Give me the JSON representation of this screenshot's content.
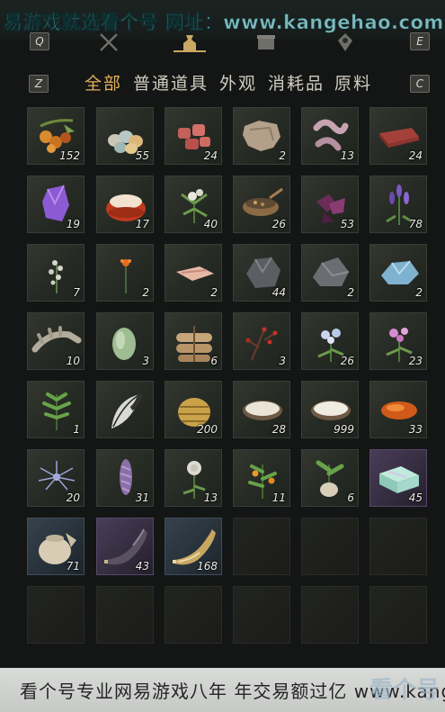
{
  "watermark_top": "易游戏就选看个号  网址：www.kangehao.com",
  "watermark_bottom": "看个号专业网易游戏八年  年交易额过亿  www.kangehao.com",
  "watermark_logo": "看个号",
  "keys": {
    "left": "Q",
    "right": "E",
    "prev_cat": "Z",
    "next_cat": "C"
  },
  "tabs": [
    {
      "icon": "crossed-swords-icon"
    },
    {
      "icon": "bag-icon"
    },
    {
      "icon": "box-icon"
    },
    {
      "icon": "gem-icon"
    }
  ],
  "active_tab": "bag-icon",
  "categories": [
    "全部",
    "普通道具",
    "外观",
    "消耗品",
    "原料"
  ],
  "active_category": "全部",
  "items": [
    {
      "icon": "fruit-branch-icon",
      "count": "152"
    },
    {
      "icon": "eggs-icon",
      "count": "55"
    },
    {
      "icon": "meat-chunks-icon",
      "count": "24"
    },
    {
      "icon": "hide-icon",
      "count": "2"
    },
    {
      "icon": "intestines-icon",
      "count": "13"
    },
    {
      "icon": "steak-icon",
      "count": "24"
    },
    {
      "icon": "amethyst-icon",
      "count": "19"
    },
    {
      "icon": "jelly-bowl-icon",
      "count": "17"
    },
    {
      "icon": "white-flower-icon",
      "count": "40"
    },
    {
      "icon": "grain-bowl-icon",
      "count": "26"
    },
    {
      "icon": "purple-flower-icon",
      "count": "53"
    },
    {
      "icon": "lavender-icon",
      "count": "78"
    },
    {
      "icon": "white-herb-icon",
      "count": "7"
    },
    {
      "icon": "orange-flower-icon",
      "count": "2"
    },
    {
      "icon": "fish-slice-icon",
      "count": "2"
    },
    {
      "icon": "grey-ore-icon",
      "count": "44"
    },
    {
      "icon": "stone-icon",
      "count": "2"
    },
    {
      "icon": "ice-crystal-icon",
      "count": "2"
    },
    {
      "icon": "bone-icon",
      "count": "10"
    },
    {
      "icon": "melon-icon",
      "count": "3"
    },
    {
      "icon": "rice-sacks-icon",
      "count": "6"
    },
    {
      "icon": "red-berry-twig-icon",
      "count": "3"
    },
    {
      "icon": "blue-flower-icon",
      "count": "26"
    },
    {
      "icon": "pink-flower-icon",
      "count": "23"
    },
    {
      "icon": "green-herb-icon",
      "count": "1"
    },
    {
      "icon": "feather-icon",
      "count": ""
    },
    {
      "icon": "woven-basket-icon",
      "count": "200"
    },
    {
      "icon": "milk-bowl-icon",
      "count": "28"
    },
    {
      "icon": "rice-bowl-icon",
      "count": "999"
    },
    {
      "icon": "amber-stone-icon",
      "count": "33"
    },
    {
      "icon": "spider-lily-icon",
      "count": "20"
    },
    {
      "icon": "purple-spike-icon",
      "count": "31"
    },
    {
      "icon": "white-rose-icon",
      "count": "13"
    },
    {
      "icon": "orange-fruit-plant-icon",
      "count": "11"
    },
    {
      "icon": "root-plant-icon",
      "count": "6"
    },
    {
      "icon": "jade-box-icon",
      "count": "45"
    },
    {
      "icon": "pottery-jar-icon",
      "count": "71"
    },
    {
      "icon": "dark-horn-icon",
      "count": "43"
    },
    {
      "icon": "golden-horn-icon",
      "count": "168"
    }
  ],
  "empty_slots": 9
}
